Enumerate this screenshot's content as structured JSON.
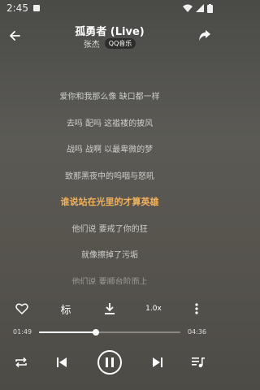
{
  "status_bar": {
    "time": "2:45"
  },
  "header": {
    "title": "孤勇者 (Live)",
    "artist": "张杰",
    "source_badge": "QQ音乐"
  },
  "lyrics": [
    {
      "text": "爱你和我那么像 缺口都一样",
      "state": "normal"
    },
    {
      "text": "去吗 配吗 这褴褛的披风",
      "state": "normal"
    },
    {
      "text": "战吗 战啊 以最卑微的梦",
      "state": "normal"
    },
    {
      "text": "致那黑夜中的呜咽与怒吼",
      "state": "normal"
    },
    {
      "text": "谁说站在光里的才算英雄",
      "state": "active"
    },
    {
      "text": "他们说 要戒了你的狂",
      "state": "normal"
    },
    {
      "text": "就像擦掉了污垢",
      "state": "normal"
    },
    {
      "text": "他们说 要顺台阶而上",
      "state": "fade"
    }
  ],
  "actions": {
    "lyric_toggle_label": "标",
    "speed_label": "1.0x"
  },
  "progress": {
    "current": "01:49",
    "total": "04:36",
    "fraction": 0.4
  },
  "colors": {
    "active_lyric": "#f0b25c"
  }
}
